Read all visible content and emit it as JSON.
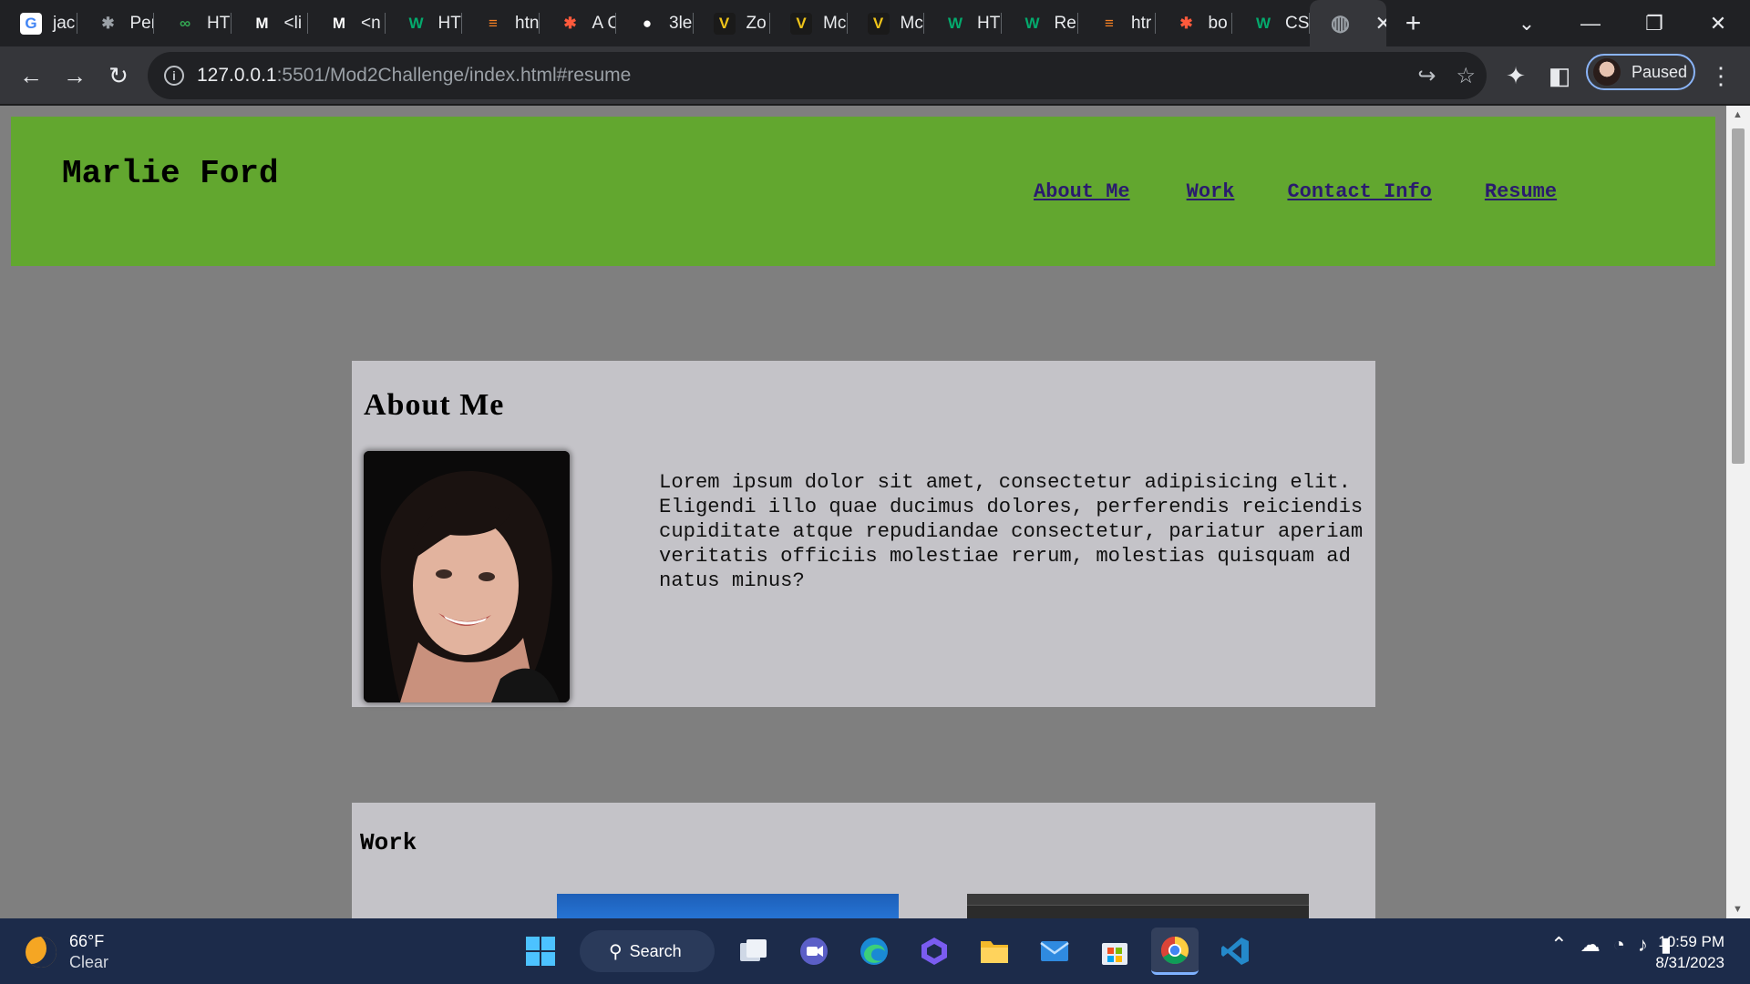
{
  "browser": {
    "tabs": [
      {
        "glyph": "G",
        "label": "jac",
        "color": "#4285f4",
        "bg": "#ffffff"
      },
      {
        "glyph": "✱",
        "label": "Per",
        "color": "#9aa0a6",
        "bg": "transparent"
      },
      {
        "glyph": "∞",
        "label": "HT",
        "color": "#34a853",
        "bg": "transparent"
      },
      {
        "glyph": "M",
        "label": "<li",
        "color": "#ffffff",
        "bg": "transparent"
      },
      {
        "glyph": "M",
        "label": "<n",
        "color": "#ffffff",
        "bg": "transparent"
      },
      {
        "glyph": "W",
        "label": "HT",
        "color": "#04aa6d",
        "bg": "transparent"
      },
      {
        "glyph": "≡",
        "label": "htn",
        "color": "#f48024",
        "bg": "transparent"
      },
      {
        "glyph": "✱",
        "label": "A C",
        "color": "#ff5a3c",
        "bg": "transparent"
      },
      {
        "glyph": "●",
        "label": "3le",
        "color": "#ffffff",
        "bg": "transparent"
      },
      {
        "glyph": "V",
        "label": "Zo",
        "color": "#f0c419",
        "bg": "#1a1a1a"
      },
      {
        "glyph": "V",
        "label": "Mc",
        "color": "#f0c419",
        "bg": "#1a1a1a"
      },
      {
        "glyph": "V",
        "label": "Mc",
        "color": "#f0c419",
        "bg": "#1a1a1a"
      },
      {
        "glyph": "W",
        "label": "HT",
        "color": "#04aa6d",
        "bg": "transparent"
      },
      {
        "glyph": "W",
        "label": "Re",
        "color": "#04aa6d",
        "bg": "transparent"
      },
      {
        "glyph": "≡",
        "label": "htr",
        "color": "#f48024",
        "bg": "transparent"
      },
      {
        "glyph": "✱",
        "label": "bo",
        "color": "#ff5a3c",
        "bg": "transparent"
      },
      {
        "glyph": "W",
        "label": "CS",
        "color": "#04aa6d",
        "bg": "transparent"
      }
    ],
    "active_tab": {
      "glyph": "◍",
      "close": "✕"
    },
    "new_tab": "+",
    "window_controls": {
      "dropdown": "⌄",
      "minimize": "—",
      "restore": "❐",
      "close": "✕"
    },
    "nav": {
      "back": "←",
      "forward": "→",
      "reload": "↻"
    },
    "address": {
      "info": "i",
      "host": "127.0.0.1",
      "path": ":5501/Mod2Challenge/index.html#resume"
    },
    "omnibox_icons": {
      "share": "↪",
      "bookmark": "☆"
    },
    "toolbar_icons": {
      "extensions": "✦",
      "sidepanel": "◧",
      "menu": "⋮"
    },
    "profile": {
      "status": "Paused"
    }
  },
  "page": {
    "header": {
      "name": "Marlie Ford",
      "nav": [
        "About Me",
        "Work",
        "Contact Info",
        "Resume"
      ]
    },
    "about": {
      "title": "About Me",
      "text": "Lorem ipsum dolor sit amet, consectetur adipisicing elit. Eligendi illo quae ducimus dolores, perferendis reiciendis cupiditate atque repudiandae consectetur, pariatur aperiam veritatis officiis molestiae rerum, molestias quisquam ad natus minus?"
    },
    "work": {
      "title": "Work"
    }
  },
  "taskbar": {
    "weather": {
      "temp": "66°F",
      "condition": "Clear"
    },
    "search_label": "Search",
    "clock": {
      "time": "10:59 PM",
      "date": "8/31/2023"
    },
    "tray": {
      "chevron": "⌃",
      "onedrive": "☁",
      "wifi": "◔",
      "volume": "♪",
      "battery": "▮"
    }
  }
}
